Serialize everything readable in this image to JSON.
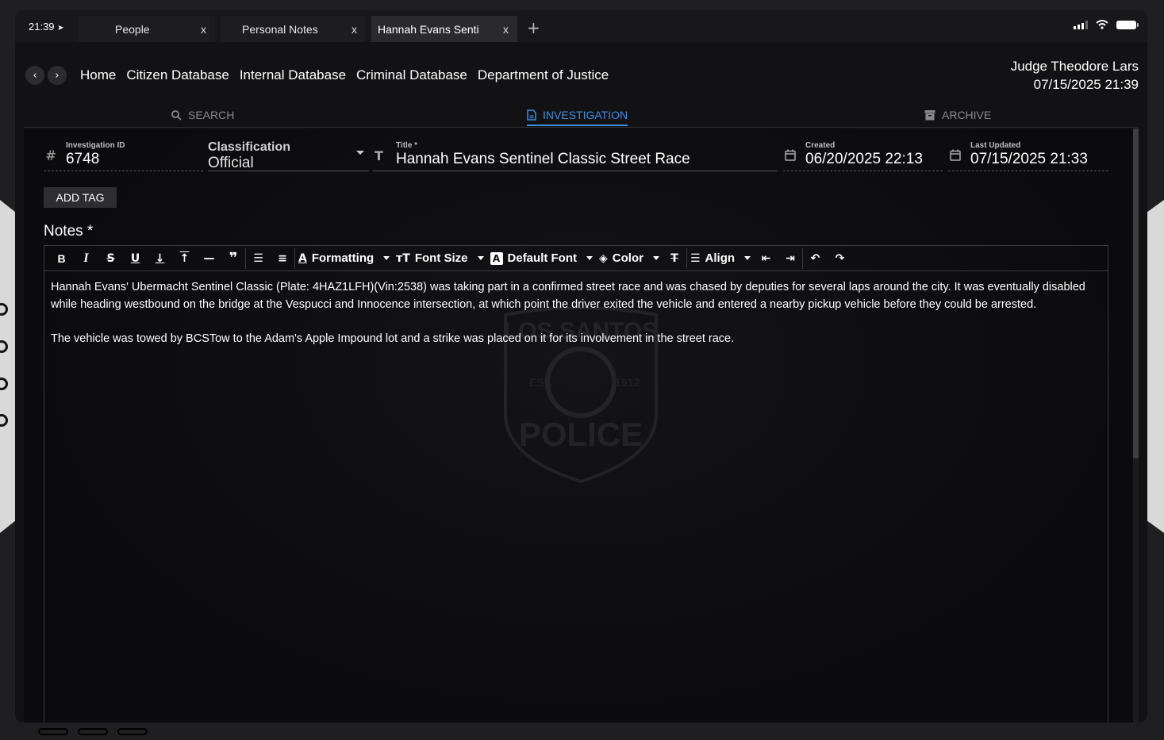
{
  "status": {
    "time": "21:39"
  },
  "tabs": [
    {
      "label": "People",
      "close": "x"
    },
    {
      "label": "Personal Notes",
      "close": "x"
    },
    {
      "label": "Hannah Evans Senti",
      "close": "x"
    }
  ],
  "tab_add": "+",
  "nav": {
    "links": [
      "Home",
      "Citizen Database",
      "Internal Database",
      "Criminal Database",
      "Department of Justice"
    ]
  },
  "user": {
    "name": "Judge Theodore Lars",
    "datetime": "07/15/2025 21:39"
  },
  "view_tabs": {
    "search": "SEARCH",
    "investigation": "INVESTIGATION",
    "archive": "ARCHIVE"
  },
  "form": {
    "id_label": "Investigation ID",
    "id_value": "6748",
    "classification_label": "Classification",
    "classification_value": "Official",
    "title_label": "Title *",
    "title_value": "Hannah Evans Sentinel Classic Street Race",
    "created_label": "Created",
    "created_value": "06/20/2025 22:13",
    "updated_label": "Last Updated",
    "updated_value": "07/15/2025 21:33",
    "add_tag": "ADD TAG",
    "notes_label": "Notes *"
  },
  "toolbar": {
    "formatting": "Formatting",
    "font_size": "Font Size",
    "default_font": "Default Font",
    "color": "Color",
    "align": "Align"
  },
  "notes": {
    "p1": "Hannah Evans' Ubermacht Sentinel Classic (Plate: 4HAZ1LFH)(Vin:2538) was taking part in a confirmed street race and was chased by deputies for several laps around the city. It was eventually disabled while heading westbound on the bridge at the Vespucci and Innocence intersection, at which point the driver exited the vehicle and entered a nearby pickup vehicle before they could be arrested.",
    "p2": "The vehicle was towed by BCSTow to the Adam's Apple Impound lot and a strike was placed on it for its involvement in the street race."
  },
  "watermark": {
    "top": "LOS SANTOS",
    "left_year": "EST.",
    "right_year": "1912",
    "bottom": "POLICE"
  },
  "colors": {
    "accent": "#3f8ee0",
    "background": "#121214"
  }
}
